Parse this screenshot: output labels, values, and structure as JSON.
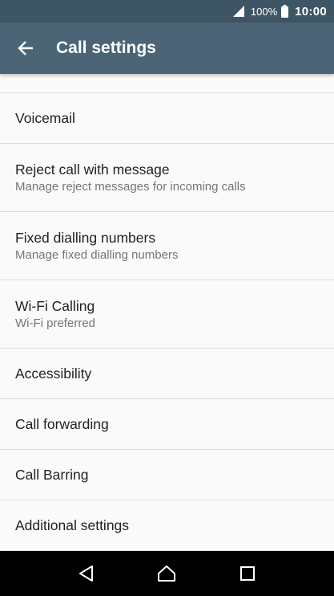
{
  "status_bar": {
    "battery_percent": "100%",
    "time": "10:00",
    "icons": [
      "signal-icon",
      "battery-icon"
    ]
  },
  "app_bar": {
    "title": "Call settings",
    "back_icon": "back-arrow-icon"
  },
  "settings": [
    {
      "title": "Voicemail",
      "subtitle": ""
    },
    {
      "title": "Reject call with message",
      "subtitle": "Manage reject messages for incoming calls"
    },
    {
      "title": "Fixed dialling numbers",
      "subtitle": "Manage fixed dialling numbers"
    },
    {
      "title": "Wi-Fi Calling",
      "subtitle": "Wi-Fi preferred"
    },
    {
      "title": "Accessibility",
      "subtitle": ""
    },
    {
      "title": "Call forwarding",
      "subtitle": ""
    },
    {
      "title": "Call Barring",
      "subtitle": ""
    },
    {
      "title": "Additional settings",
      "subtitle": ""
    }
  ],
  "nav_bar": {
    "icons": [
      "back-triangle-icon",
      "home-icon",
      "recents-icon"
    ]
  },
  "colors": {
    "status_bar": "#3e5566",
    "app_bar": "#4b6576",
    "background": "#fafafa",
    "divider": "#dcdcdc",
    "primary_text": "#222222",
    "secondary_text": "#757575"
  }
}
